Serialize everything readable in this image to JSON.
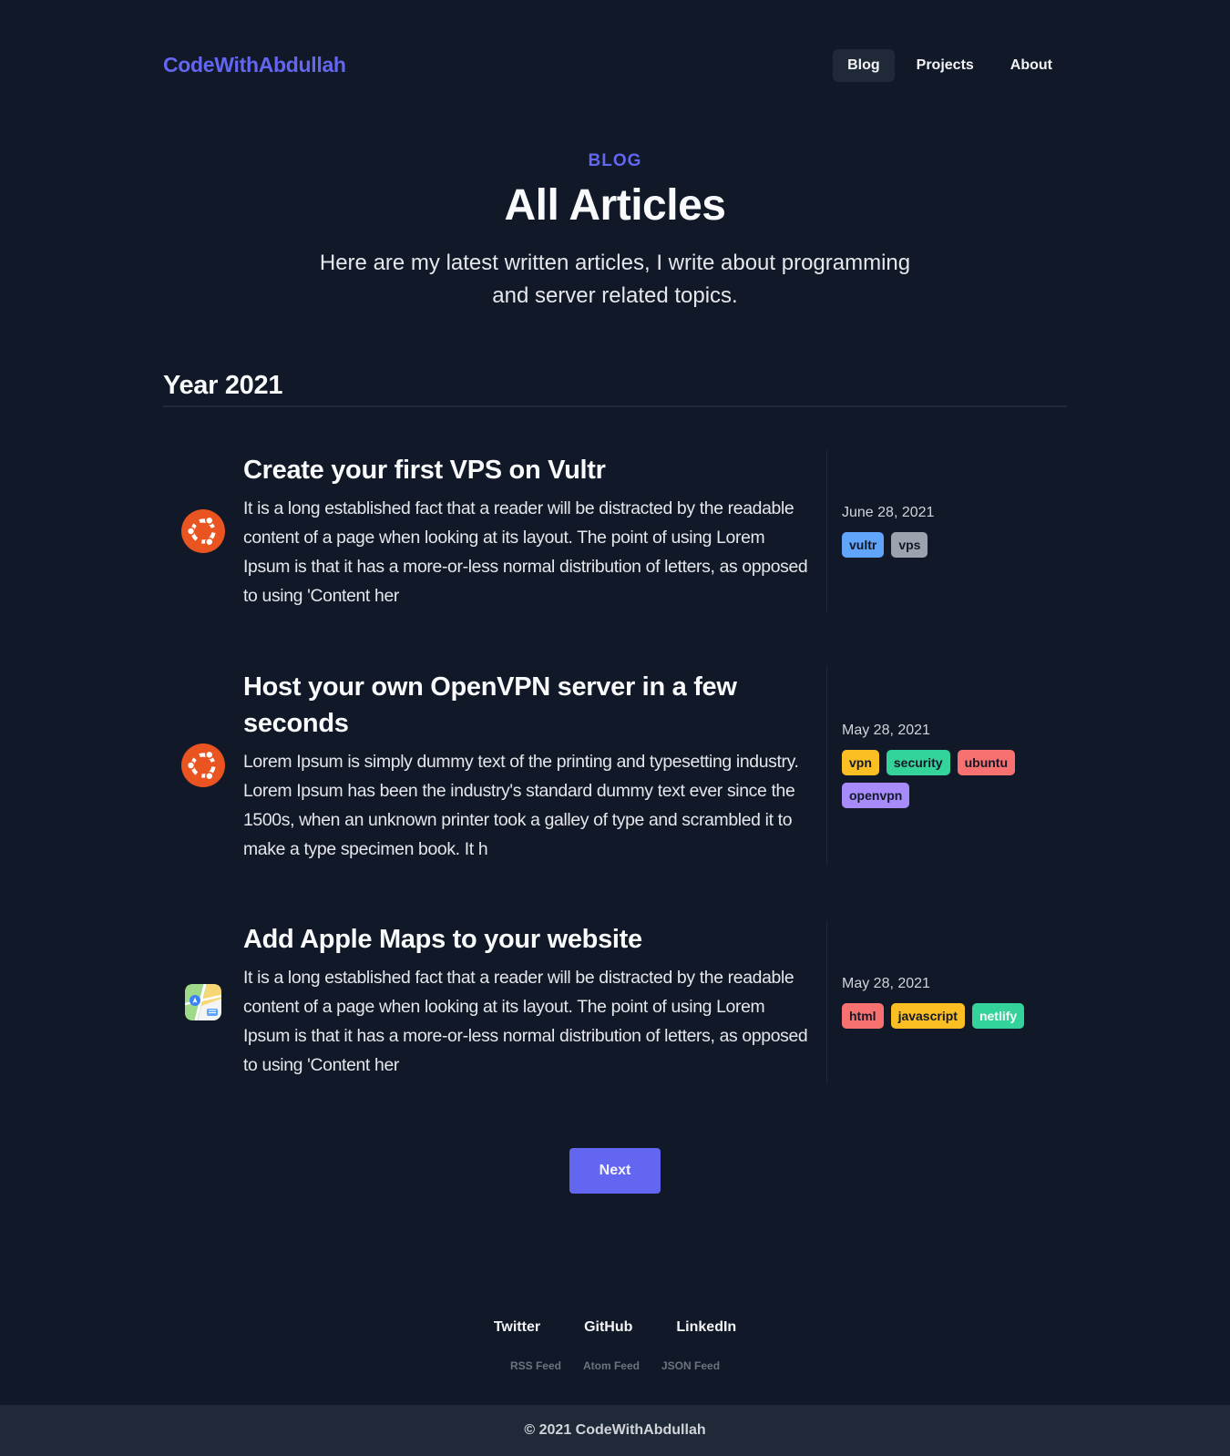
{
  "site": {
    "logo": "CodeWithAbdullah"
  },
  "nav": {
    "items": [
      {
        "label": "Blog",
        "active": true
      },
      {
        "label": "Projects",
        "active": false
      },
      {
        "label": "About",
        "active": false
      }
    ]
  },
  "hero": {
    "eyebrow": "BLOG",
    "title": "All Articles",
    "subtitle": "Here are my latest written articles, I write about programming and server related topics."
  },
  "year": {
    "label": "Year 2021"
  },
  "articles": [
    {
      "icon": "ubuntu-icon",
      "title": "Create your first VPS on Vultr",
      "excerpt": "It is a long established fact that a reader will be distracted by the readable content of a page when looking at its layout. The point of using Lorem Ipsum is that it has a more-or-less normal distribution of letters, as opposed to using 'Content her",
      "date": "June 28, 2021",
      "tags": [
        {
          "label": "vultr",
          "color": "#60a5fa"
        },
        {
          "label": "vps",
          "color": "#9ca3af"
        }
      ]
    },
    {
      "icon": "ubuntu-icon",
      "title": "Host your own OpenVPN server in a few seconds",
      "excerpt": "Lorem Ipsum is simply dummy text of the printing and typesetting industry. Lorem Ipsum has been the industry's standard dummy text ever since the 1500s, when an unknown printer took a galley of type and scrambled it to make a type specimen book. It h",
      "date": "May 28, 2021",
      "tags": [
        {
          "label": "vpn",
          "color": "#fbbf24"
        },
        {
          "label": "security",
          "color": "#34d399"
        },
        {
          "label": "ubuntu",
          "color": "#f87171"
        },
        {
          "label": "openvpn",
          "color": "#a78bfa"
        }
      ]
    },
    {
      "icon": "apple-maps-icon",
      "title": "Add Apple Maps to your website",
      "excerpt": "It is a long established fact that a reader will be distracted by the readable content of a page when looking at its layout. The point of using Lorem Ipsum is that it has a more-or-less normal distribution of letters, as opposed to using 'Content her",
      "date": "May 28, 2021",
      "tags": [
        {
          "label": "html",
          "color": "#f87171"
        },
        {
          "label": "javascript",
          "color": "#fbbf24"
        },
        {
          "label": "netlify",
          "color": "#34d399",
          "light_text": true
        }
      ]
    }
  ],
  "pagination": {
    "next_label": "Next"
  },
  "footer": {
    "social": [
      "Twitter",
      "GitHub",
      "LinkedIn"
    ],
    "feeds": [
      "RSS Feed",
      "Atom Feed",
      "JSON Feed"
    ],
    "copyright": "© 2021 CodeWithAbdullah"
  },
  "colors": {
    "background": "#111827",
    "accent": "#6366f1",
    "surface": "#1f2937",
    "ubuntu_orange": "#e95420"
  }
}
